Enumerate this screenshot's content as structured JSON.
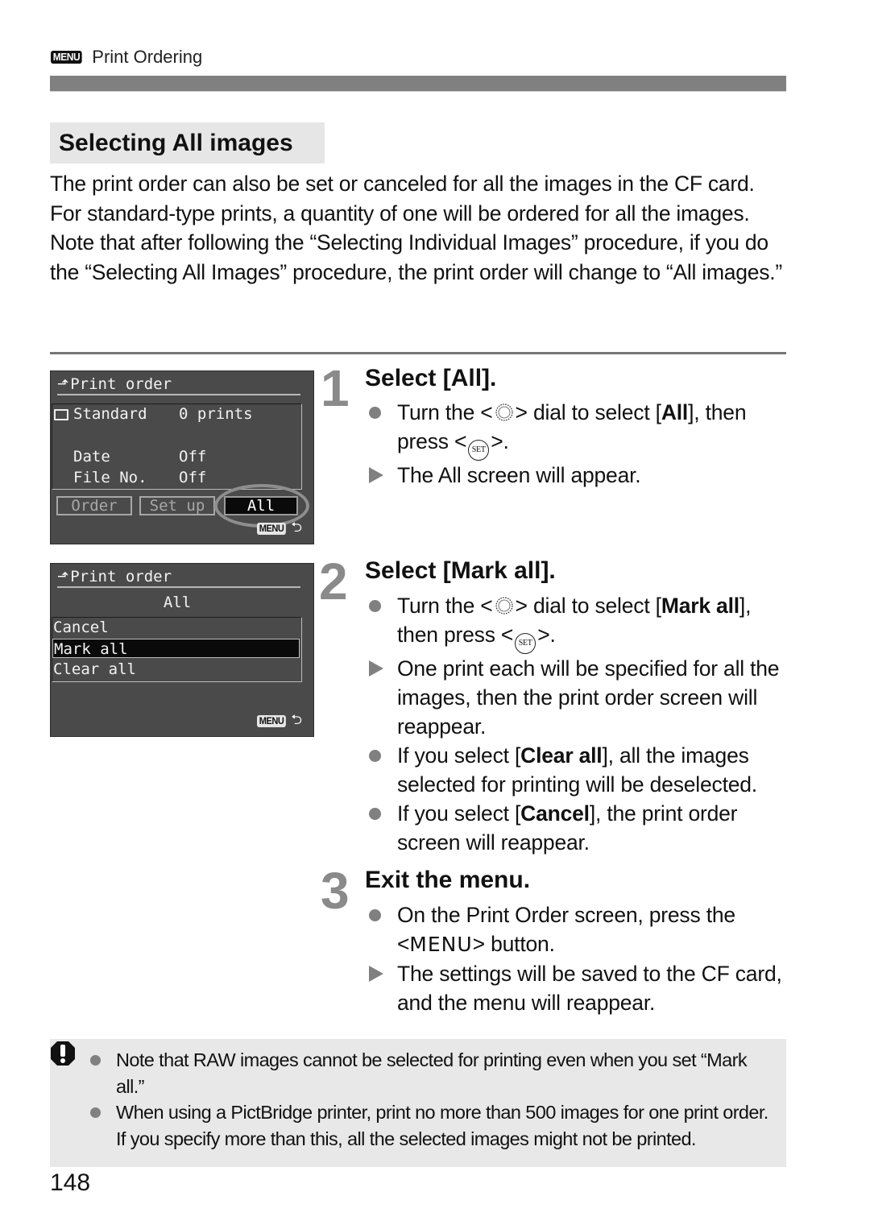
{
  "header": {
    "menu_badge": "MENU",
    "section": "Print Ordering"
  },
  "section_title": "Selecting All images",
  "intro": {
    "p1": "The print order can also be set or canceled for all the images in the CF card. For standard-type prints, a quantity of one will be ordered for all the images.",
    "p2": "Note that after following the “Selecting Individual Images” procedure, if you do the “Selecting All Images” procedure, the print order will change to “All images.”"
  },
  "screen1": {
    "title": "Print order",
    "rows": [
      {
        "label": "Standard",
        "value": "0 prints"
      },
      {
        "label": "Date",
        "value": "Off"
      },
      {
        "label": "File No.",
        "value": "Off"
      }
    ],
    "buttons": [
      "Order",
      "Set up",
      "All"
    ],
    "selected_button": "All",
    "back_badge": "MENU",
    "back_symbol": "⮌"
  },
  "screen2": {
    "title": "Print order",
    "subtitle": "All",
    "items": [
      "Cancel",
      "Mark all",
      "Clear all"
    ],
    "selected_item": "Mark all",
    "back_badge": "MENU",
    "back_symbol": "⮌"
  },
  "steps": [
    {
      "number": "1",
      "title": "Select [All].",
      "bullets": [
        {
          "type": "dot",
          "pre": "Turn the <",
          "mid": "> dial to select [",
          "bold": "All",
          "post": "], then press <",
          "end": ">."
        },
        {
          "type": "arrow",
          "text": "The All screen will appear."
        }
      ]
    },
    {
      "number": "2",
      "title": "Select [Mark all].",
      "bullets": [
        {
          "type": "dot",
          "pre": "Turn the <",
          "mid": "> dial to select [",
          "bold": "Mark all",
          "post": "], then press <",
          "end": ">."
        },
        {
          "type": "arrow",
          "text": "One print each will be specified for all the images, then the print order screen will reappear."
        },
        {
          "type": "dot",
          "pre": "If you select [",
          "bold": "Clear all",
          "post": "], all the images selected for printing will be deselected."
        },
        {
          "type": "dot",
          "pre": "If you select [",
          "bold": "Cancel",
          "post": "], the print order screen will reappear."
        }
      ]
    },
    {
      "number": "3",
      "title": "Exit the menu.",
      "bullets": [
        {
          "type": "dot",
          "pre": "On the Print Order screen, press the <",
          "menu": "MENU",
          "post": "> button."
        },
        {
          "type": "arrow",
          "text": "The settings will be saved to the CF card, and the menu will reappear."
        }
      ]
    }
  ],
  "icons": {
    "dial": "main-dial-icon",
    "set": "SET",
    "caution": "caution-icon"
  },
  "caution": [
    "Note that RAW images cannot be selected for printing even when you set “Mark all.”",
    "When using a PictBridge printer, print no more than 500 images for one print order. If you specify more than this, all the selected images might not be printed."
  ],
  "page_number": "148"
}
